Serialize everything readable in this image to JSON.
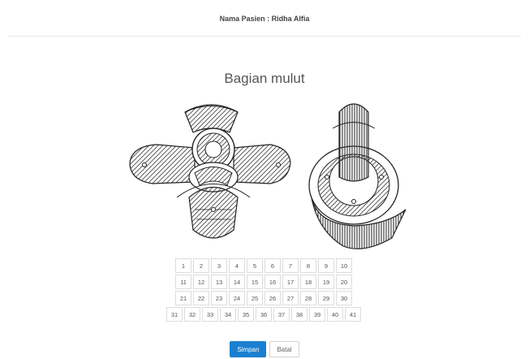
{
  "header": {
    "patient_label": "Nama Pasien : Ridha Alfia"
  },
  "section": {
    "title": "Bagian mulut"
  },
  "tooth_grid": {
    "rows": [
      [
        "1",
        "2",
        "3",
        "4",
        "5",
        "6",
        "7",
        "8",
        "9",
        "10"
      ],
      [
        "11",
        "12",
        "13",
        "14",
        "15",
        "16",
        "17",
        "18",
        "19",
        "20"
      ],
      [
        "21",
        "22",
        "23",
        "24",
        "25",
        "26",
        "27",
        "28",
        "29",
        "30"
      ],
      [
        "31",
        "32",
        "33",
        "34",
        "35",
        "36",
        "37",
        "38",
        "39",
        "40",
        "41"
      ]
    ]
  },
  "actions": {
    "save_label": "Simpan",
    "cancel_label": "Batal"
  },
  "colors": {
    "primary": "#1a7fd0",
    "border": "#dcdcdc"
  }
}
